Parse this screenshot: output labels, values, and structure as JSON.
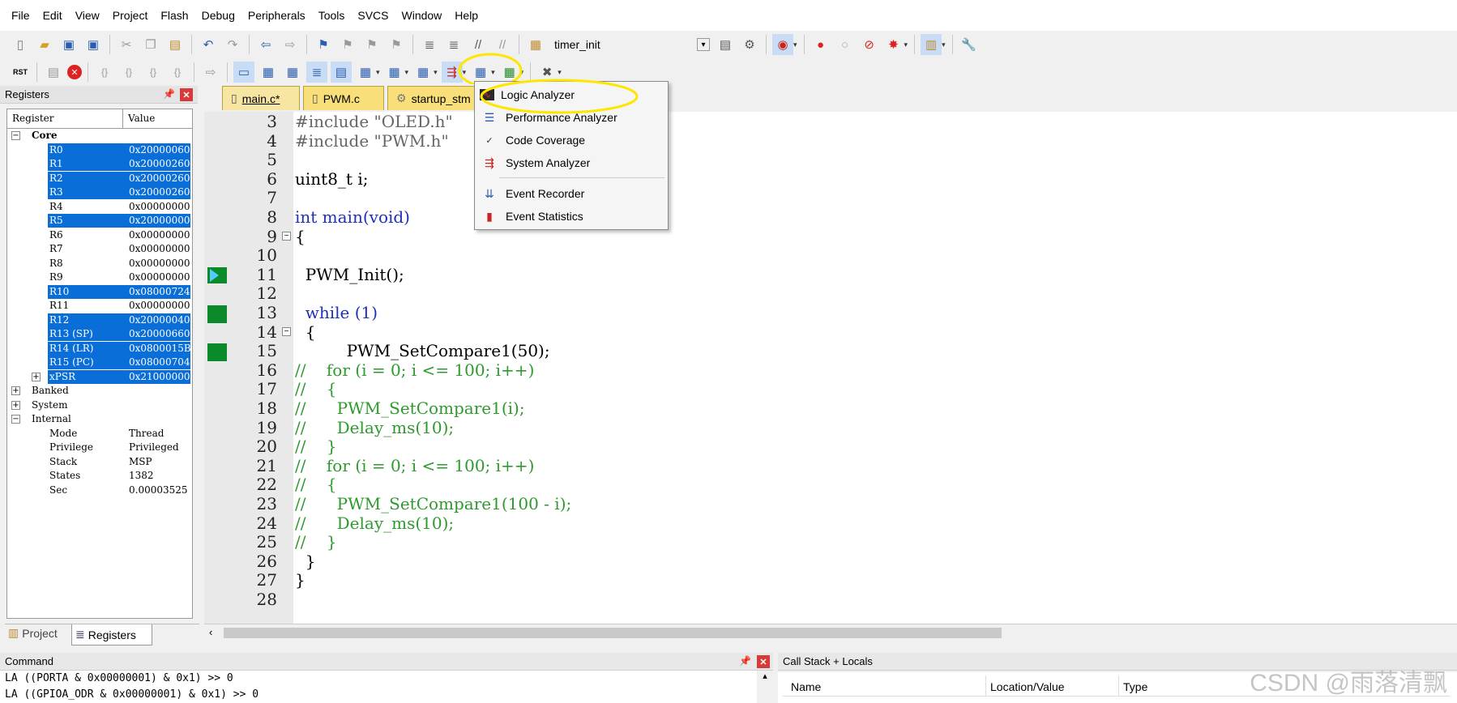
{
  "menu": [
    "File",
    "Edit",
    "View",
    "Project",
    "Flash",
    "Debug",
    "Peripherals",
    "Tools",
    "SVCS",
    "Window",
    "Help"
  ],
  "toolbar": {
    "target_name": "timer_init"
  },
  "registers_panel": {
    "title": "Registers",
    "col_register": "Register",
    "col_value": "Value",
    "core_label": "Core",
    "rows": [
      {
        "name": "R0",
        "value": "0x20000060",
        "selected": true
      },
      {
        "name": "R1",
        "value": "0x20000260",
        "selected": true
      },
      {
        "name": "R2",
        "value": "0x20000260",
        "selected": true
      },
      {
        "name": "R3",
        "value": "0x20000260",
        "selected": true
      },
      {
        "name": "R4",
        "value": "0x00000000",
        "selected": false
      },
      {
        "name": "R5",
        "value": "0x20000000",
        "selected": true
      },
      {
        "name": "R6",
        "value": "0x00000000",
        "selected": false
      },
      {
        "name": "R7",
        "value": "0x00000000",
        "selected": false
      },
      {
        "name": "R8",
        "value": "0x00000000",
        "selected": false
      },
      {
        "name": "R9",
        "value": "0x00000000",
        "selected": false
      },
      {
        "name": "R10",
        "value": "0x08000724",
        "selected": true
      },
      {
        "name": "R11",
        "value": "0x00000000",
        "selected": false
      },
      {
        "name": "R12",
        "value": "0x20000040",
        "selected": true
      },
      {
        "name": "R13 (SP)",
        "value": "0x20000660",
        "selected": true
      },
      {
        "name": "R14 (LR)",
        "value": "0x0800015B",
        "selected": true
      },
      {
        "name": "R15 (PC)",
        "value": "0x08000704",
        "selected": true
      },
      {
        "name": "xPSR",
        "value": "0x21000000",
        "selected": true
      }
    ],
    "groups": [
      "Banked",
      "System",
      "Internal"
    ],
    "internal": [
      {
        "name": "Mode",
        "value": "Thread"
      },
      {
        "name": "Privilege",
        "value": "Privileged"
      },
      {
        "name": "Stack",
        "value": "MSP"
      },
      {
        "name": "States",
        "value": "1382"
      },
      {
        "name": "Sec",
        "value": "0.00003525"
      }
    ],
    "tab_project": "Project",
    "tab_registers": "Registers"
  },
  "tabs": [
    "main.c*",
    "PWM.c",
    "startup_stm"
  ],
  "code_lines": [
    {
      "n": "3",
      "text": "#include \"OLED.h\"",
      "cls": "pp"
    },
    {
      "n": "4",
      "text": "#include \"PWM.h\"",
      "cls": "pp"
    },
    {
      "n": "5",
      "text": "",
      "cls": ""
    },
    {
      "n": "6",
      "text": "uint8_t i;",
      "cls": ""
    },
    {
      "n": "7",
      "text": "",
      "cls": ""
    },
    {
      "n": "8",
      "text": "int main(void)",
      "cls": "kw"
    },
    {
      "n": "9",
      "text": "{",
      "cls": ""
    },
    {
      "n": "10",
      "text": "",
      "cls": ""
    },
    {
      "n": "11",
      "text": "  PWM_Init();",
      "cls": ""
    },
    {
      "n": "12",
      "text": "",
      "cls": ""
    },
    {
      "n": "13",
      "text": "  while (1)",
      "cls": "kw"
    },
    {
      "n": "14",
      "text": "  {",
      "cls": ""
    },
    {
      "n": "15",
      "text": "          PWM_SetCompare1(50);",
      "cls": ""
    },
    {
      "n": "16",
      "text": "//    for (i = 0; i <= 100; i++)",
      "cls": "cm"
    },
    {
      "n": "17",
      "text": "//    {",
      "cls": "cm"
    },
    {
      "n": "18",
      "text": "//      PWM_SetCompare1(i);",
      "cls": "cm"
    },
    {
      "n": "19",
      "text": "//      Delay_ms(10);",
      "cls": "cm"
    },
    {
      "n": "20",
      "text": "//    }",
      "cls": "cm"
    },
    {
      "n": "21",
      "text": "//    for (i = 0; i <= 100; i++)",
      "cls": "cm"
    },
    {
      "n": "22",
      "text": "//    {",
      "cls": "cm"
    },
    {
      "n": "23",
      "text": "//      PWM_SetCompare1(100 - i);",
      "cls": "cm"
    },
    {
      "n": "24",
      "text": "//      Delay_ms(10);",
      "cls": "cm"
    },
    {
      "n": "25",
      "text": "//    }",
      "cls": "cm"
    },
    {
      "n": "26",
      "text": "  }",
      "cls": ""
    },
    {
      "n": "27",
      "text": "}",
      "cls": ""
    },
    {
      "n": "28",
      "text": "",
      "cls": ""
    }
  ],
  "dropdown": {
    "items": [
      "Logic Analyzer",
      "Performance Analyzer",
      "Code Coverage",
      "System Analyzer",
      "Event Recorder",
      "Event Statistics"
    ]
  },
  "command_panel": {
    "title": "Command",
    "lines": [
      "LA ((PORTA & 0x00000001) & 0x1) >> 0",
      "LA ((GPIOA_ODR & 0x00000001) & 0x1) >> 0"
    ]
  },
  "callstack_panel": {
    "title": "Call Stack + Locals",
    "col_name": "Name",
    "col_location": "Location/Value",
    "col_type": "Type"
  },
  "watermark": "CSDN @雨落清飘",
  "colors": {
    "highlight": "#ffe600",
    "selection": "#0a6ed8",
    "exec_marker": "#0a8a2a",
    "comment": "#2e9a2e",
    "keyword": "#1e2fb8"
  }
}
